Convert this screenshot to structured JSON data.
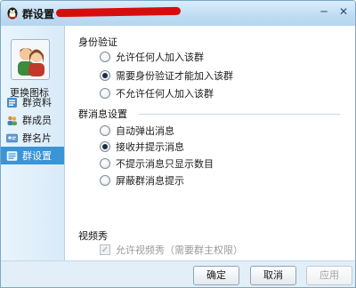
{
  "window": {
    "title": "群设置",
    "icon": "qq-penguin-icon",
    "controls": {
      "minimize": "─",
      "close": "✕"
    }
  },
  "sidebar": {
    "change_icon_label": "更换图标",
    "items": [
      {
        "label": "群资料",
        "icon": "group-info-icon",
        "active": false
      },
      {
        "label": "群成员",
        "icon": "group-members-icon",
        "active": false
      },
      {
        "label": "群名片",
        "icon": "group-card-icon",
        "active": false
      },
      {
        "label": "群设置",
        "icon": "group-settings-icon",
        "active": true
      }
    ]
  },
  "identity": {
    "title": "身份验证",
    "options": [
      {
        "label": "允许任何人加入该群",
        "checked": false
      },
      {
        "label": "需要身份验证才能加入该群",
        "checked": true
      },
      {
        "label": "不允许任何人加入该群",
        "checked": false
      }
    ]
  },
  "messages": {
    "title": "群消息设置",
    "options": [
      {
        "label": "自动弹出消息",
        "checked": false
      },
      {
        "label": "接收并提示消息",
        "checked": true
      },
      {
        "label": "不提示消息只显示数目",
        "checked": false
      },
      {
        "label": "屏蔽群消息提示",
        "checked": false
      }
    ]
  },
  "video": {
    "title": "视频秀",
    "checkbox_label": "允许视频秀（需要群主权限）",
    "checked": true,
    "disabled": true
  },
  "buttons": {
    "ok": "确定",
    "cancel": "取消",
    "apply": "应用"
  },
  "colors": {
    "accent": "#3a94d6",
    "redaction": "#d70d0d",
    "titlebar": "#bfdcf2"
  }
}
